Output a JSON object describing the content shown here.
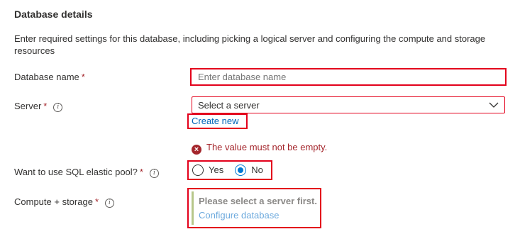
{
  "section": {
    "title": "Database details",
    "description": "Enter required settings for this database, including picking a logical server and configuring the compute and storage resources"
  },
  "fields": {
    "database_name": {
      "label": "Database name",
      "required_mark": "*",
      "placeholder": "Enter database name",
      "value": ""
    },
    "server": {
      "label": "Server",
      "required_mark": "*",
      "info_icon": "info-icon",
      "selected_value": "Select a server",
      "create_new_link": "Create new",
      "error_message": "The value must not be empty."
    },
    "elastic_pool": {
      "label": "Want to use SQL elastic pool?",
      "required_mark": "*",
      "info_icon": "info-icon",
      "options": [
        "Yes",
        "No"
      ],
      "selected": "No"
    },
    "compute_storage": {
      "label": "Compute + storage",
      "required_mark": "*",
      "info_icon": "info-icon",
      "message": "Please select a server first.",
      "configure_link": "Configure database"
    }
  },
  "colors": {
    "highlight": "#e3001b",
    "error": "#a4262c",
    "link": "#0066b8",
    "radio_accent": "#0078d4",
    "disabled_link": "#6ca9dd"
  }
}
